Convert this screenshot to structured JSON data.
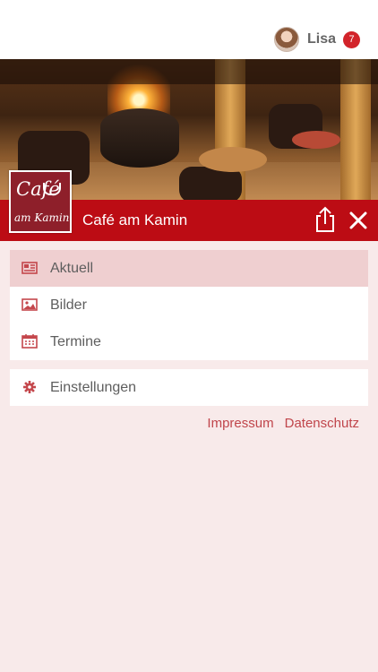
{
  "user": {
    "name": "Lisa",
    "badge_count": "7"
  },
  "header": {
    "title": "Café am Kamin"
  },
  "logo": {
    "line1": "Café",
    "line2": "am Kamin"
  },
  "menu": {
    "primary": [
      {
        "label": "Aktuell",
        "icon": "newspaper-icon",
        "active": true
      },
      {
        "label": "Bilder",
        "icon": "image-icon",
        "active": false
      },
      {
        "label": "Termine",
        "icon": "calendar-icon",
        "active": false
      }
    ],
    "secondary": [
      {
        "label": "Einstellungen",
        "icon": "gear-icon"
      }
    ]
  },
  "footer": {
    "impressum": "Impressum",
    "datenschutz": "Datenschutz"
  },
  "colors": {
    "accent": "#bc0c14",
    "background": "#f8eaea",
    "active_item": "#efcfd0",
    "link": "#c0454b",
    "icon": "#c4474c"
  }
}
